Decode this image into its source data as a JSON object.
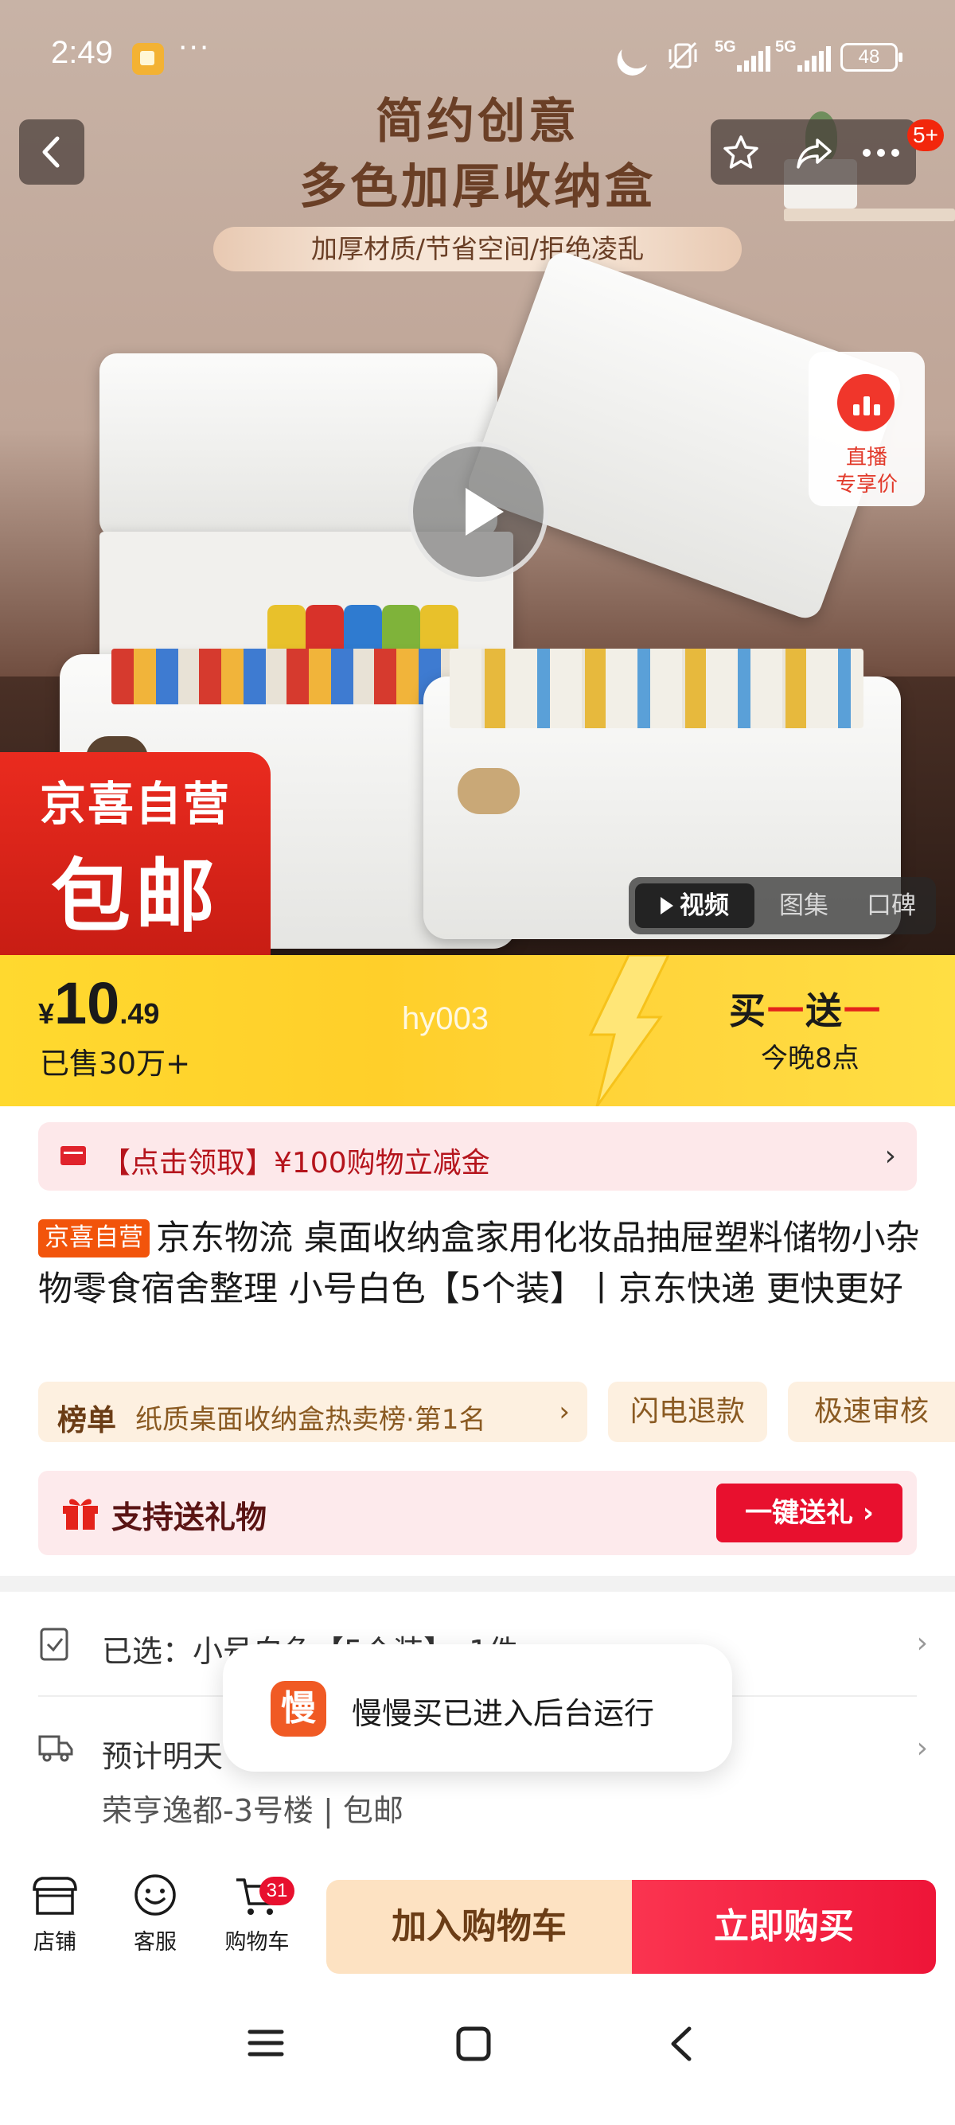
{
  "status_bar": {
    "time": "2:49",
    "more": "···",
    "network1": "5G",
    "network2": "5G",
    "battery": "48"
  },
  "top_nav": {
    "cart_badge": "5+",
    "icons": [
      "back-icon",
      "star-icon",
      "share-icon",
      "more-icon"
    ]
  },
  "hero": {
    "title_line1": "简约创意",
    "title_line2": "多色加厚收纳盒",
    "subtitle": "加厚材质/节省空间/拒绝凌乱",
    "live": {
      "line1": "直播",
      "line2": "专享价"
    },
    "badge_top": "京喜自营",
    "badge_main": "包邮",
    "media_tabs": [
      "视频",
      "图集",
      "口碑"
    ]
  },
  "price_banner": {
    "currency": "¥",
    "price_int": "10",
    "price_dec": ".49",
    "sold": "已售30万+",
    "watermark": "hy003",
    "promo_part1": "买",
    "promo_dash1": "一",
    "promo_part2": "送",
    "promo_dash2": "一",
    "promo_time": "今晚8点"
  },
  "product": {
    "coupon_text": "【点击领取】¥100购物立减金",
    "self_tag": "京喜自营",
    "title": "京东物流 桌面收纳盒家用化妆品抽屉塑料储物小杂物零食宿舍整理 小号白色【5个装】丨京东快递 更快更好",
    "rank_key": "榜单",
    "rank_value": "纸质桌面收纳盒热卖榜·第1名",
    "services": [
      "闪电退款",
      "极速审核"
    ],
    "gift_text": "支持送礼物",
    "gift_button": "一键送礼"
  },
  "selection": {
    "selected_label": "已选：小号白色【5个装】，1件",
    "delivery_label": "预计明天",
    "address": "荣亨逸都-3号楼 | 包邮"
  },
  "toast": {
    "icon_text": "慢",
    "message": "慢慢买已进入后台运行"
  },
  "action_bar": {
    "store": "店铺",
    "service": "客服",
    "cart": "购物车",
    "cart_count": "31",
    "add_to_cart": "加入购物车",
    "buy_now": "立即购买"
  },
  "colors": {
    "brand_red": "#e8102e",
    "price_yellow": "#ffd92f",
    "self_tag_orange": "#f2540b"
  }
}
